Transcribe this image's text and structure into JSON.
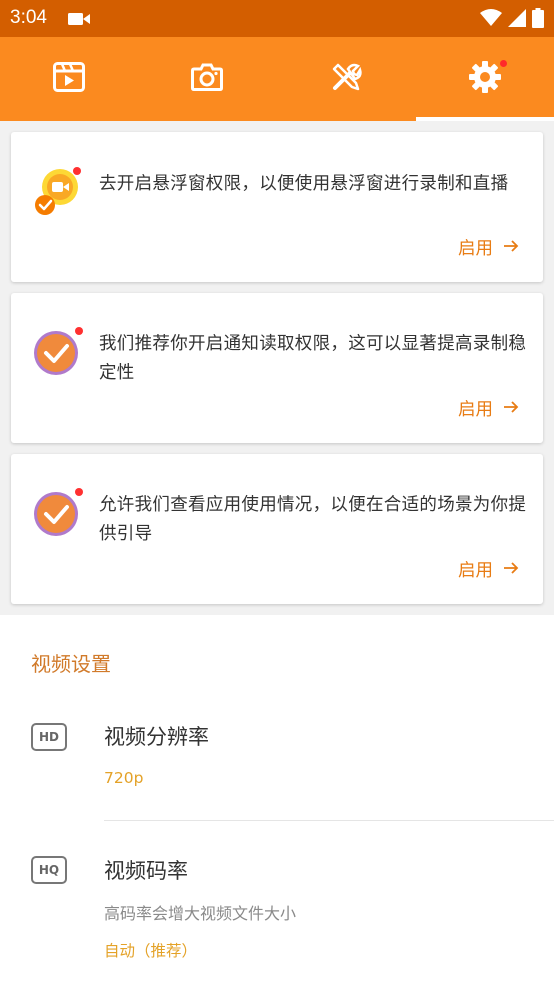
{
  "status_bar": {
    "time": "3:04"
  },
  "tabs": [
    {
      "name": "video-list",
      "icon": "video-icon"
    },
    {
      "name": "screenshot",
      "icon": "camera-icon"
    },
    {
      "name": "tools",
      "icon": "tools-icon"
    },
    {
      "name": "settings",
      "icon": "gear-icon",
      "selected": true,
      "badge": true
    }
  ],
  "cards": [
    {
      "text": "去开启悬浮窗权限，以便使用悬浮窗进行录制和直播",
      "action": "启用"
    },
    {
      "text": "我们推荐你开启通知读取权限，这可以显著提高录制稳定性",
      "action": "启用"
    },
    {
      "text": "允许我们查看应用使用情况，以便在合适的场景为你提供引导",
      "action": "启用"
    }
  ],
  "video_settings": {
    "section_title": "视频设置",
    "resolution": {
      "icon_label": "HD",
      "title": "视频分辨率",
      "value": "720p"
    },
    "bitrate": {
      "icon_label": "HQ",
      "title": "视频码率",
      "subtitle": "高码率会增大视频文件大小",
      "value": "自动（推荐）"
    }
  },
  "colors": {
    "accent": "#fb8a1f",
    "status_bar": "#d35e00",
    "action": "#e87c14",
    "value": "#e4a228"
  }
}
